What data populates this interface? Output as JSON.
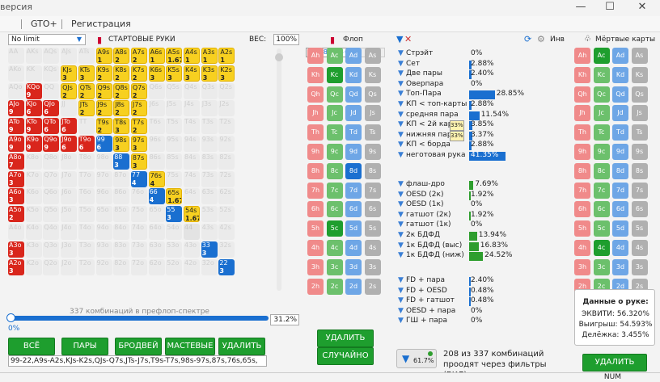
{
  "window": {
    "title": "версия"
  },
  "menu": {
    "items": [
      "GTO+",
      "Регистрация"
    ]
  },
  "left": {
    "mode_select": "No limit",
    "header": "СТАРТОВЫЕ РУКИ",
    "weight_label": "ВЕС:",
    "weight_value": "100%",
    "combos_caption": "337 комбинаций в префлоп-спектре",
    "slider_pct": "31.2%",
    "slider_left": "0%",
    "buttons": [
      "ВСЁ",
      "ПАРЫ",
      "БРОДВЕЙ",
      "МАСТЕВЫЕ",
      "УДАЛИТЬ"
    ],
    "range_text": "99-22,A9s-A2s,KJs-K2s,QJs-Q7s,JTs-J7s,T9s-T7s,98s-97s,87s,76s,65s,"
  },
  "grid": {
    "ranks": [
      "A",
      "K",
      "Q",
      "J",
      "T",
      "9",
      "8",
      "7",
      "6",
      "5",
      "4",
      "3",
      "2"
    ],
    "cells": {
      "A9s": [
        "y",
        "1",
        "2"
      ],
      "A8s": [
        "y",
        "2",
        ""
      ],
      "A7s": [
        "y",
        "2",
        ""
      ],
      "A6s": [
        "y",
        "1",
        ""
      ],
      "A5s": [
        "y",
        "1.67",
        ""
      ],
      "A4s": [
        "y",
        "1",
        ""
      ],
      "A3s": [
        "y",
        "1",
        ""
      ],
      "A2s": [
        "y",
        "1",
        ""
      ],
      "KJs": [
        "y",
        "3",
        ""
      ],
      "KTs": [
        "y",
        "3",
        ""
      ],
      "K9s": [
        "y",
        "2",
        ""
      ],
      "K8s": [
        "y",
        "2",
        ""
      ],
      "K7s": [
        "y",
        "2",
        ""
      ],
      "K6s": [
        "y",
        "3",
        ""
      ],
      "K5s": [
        "y",
        "3",
        ""
      ],
      "K4s": [
        "y",
        "3",
        ""
      ],
      "K3s": [
        "y",
        "3",
        ""
      ],
      "K2s": [
        "y",
        "3",
        ""
      ],
      "KQo": [
        "r",
        "9",
        ""
      ],
      "QJs": [
        "y",
        "2",
        ""
      ],
      "QTs": [
        "y",
        "2",
        ""
      ],
      "Q9s": [
        "y",
        "2",
        ""
      ],
      "Q8s": [
        "y",
        "2",
        ""
      ],
      "Q7s": [
        "y",
        "2",
        ""
      ],
      "AJo": [
        "r",
        "9",
        ""
      ],
      "KJo": [
        "r",
        "6",
        ""
      ],
      "QJo": [
        "r",
        "6",
        ""
      ],
      "JTs": [
        "y",
        "2",
        ""
      ],
      "J9s": [
        "y",
        "2",
        ""
      ],
      "J8s": [
        "y",
        "2",
        ""
      ],
      "J7s": [
        "y",
        "2",
        ""
      ],
      "ATo": [
        "r",
        "9",
        ""
      ],
      "KTo": [
        "r",
        "9",
        ""
      ],
      "QTo": [
        "r",
        "6",
        ""
      ],
      "JTo": [
        "r",
        "6",
        ""
      ],
      "T9s": [
        "y",
        "2",
        ""
      ],
      "T8s": [
        "y",
        "3",
        ""
      ],
      "T7s": [
        "y",
        "2",
        ""
      ],
      "A9o": [
        "r",
        "9",
        ""
      ],
      "K9o": [
        "r",
        "9",
        ""
      ],
      "Q9o": [
        "r",
        "9",
        ""
      ],
      "J9o": [
        "r",
        "6",
        ""
      ],
      "T9o": [
        "r",
        "6",
        ""
      ],
      "99": [
        "b",
        "6",
        ""
      ],
      "98s": [
        "y",
        "3",
        ""
      ],
      "97s": [
        "y",
        "3",
        ""
      ],
      "A8o": [
        "r",
        "7",
        ""
      ],
      "88": [
        "b",
        "3",
        ""
      ],
      "87s": [
        "y",
        "3",
        ""
      ],
      "A7o": [
        "r",
        "3",
        ""
      ],
      "77": [
        "b",
        "4",
        ""
      ],
      "76s": [
        "y",
        "4",
        ""
      ],
      "A6o": [
        "r",
        "3",
        ""
      ],
      "66": [
        "b",
        "4",
        ""
      ],
      "65s": [
        "y",
        "1.67",
        ""
      ],
      "A5o": [
        "r",
        "2",
        ""
      ],
      "55": [
        "b",
        "3",
        ""
      ],
      "54s": [
        "y",
        "1.67",
        ""
      ],
      "A3o": [
        "r",
        "3",
        ""
      ],
      "33": [
        "b",
        "3",
        ""
      ],
      "A2o": [
        "r",
        "3",
        ""
      ],
      "22": [
        "b",
        "3",
        ""
      ]
    },
    "greyed": [
      "44"
    ]
  },
  "flop": {
    "title": "Флоп",
    "board": [
      "K♣",
      "8♦",
      "5♦"
    ],
    "delete_btn": "УДАЛИТЬ",
    "random_btn": "СЛУЧАЙНО"
  },
  "stats": {
    "made": [
      {
        "label": "Стрэйт",
        "pct": "0%",
        "frac": 0
      },
      {
        "label": "Сет",
        "pct": "2.88%",
        "frac": 0.0288
      },
      {
        "label": "Две пары",
        "pct": "2.40%",
        "frac": 0.024
      },
      {
        "label": "Оверпара",
        "pct": "0%",
        "frac": 0
      },
      {
        "label": "Топ-Пара",
        "pct": "28.85%",
        "frac": 0.2885
      },
      {
        "label": "КП < топ-карты",
        "pct": "2.88%",
        "frac": 0.0288
      },
      {
        "label": "средняя пара",
        "pct": "11.54%",
        "frac": 0.1154
      },
      {
        "label": "КП < 2й карты",
        "pct": "3.85%",
        "frac": 0.0385,
        "badge": "33%"
      },
      {
        "label": "нижняя пара",
        "pct": "3.37%",
        "frac": 0.0337,
        "badge": "33%"
      },
      {
        "label": "КП < борда",
        "pct": "2.88%",
        "frac": 0.0288
      },
      {
        "label": "неготовая рука",
        "pct": "41.35%",
        "frac": 0.4135
      }
    ],
    "draws": [
      {
        "label": "флаш-дро",
        "pct": "7.69%",
        "frac": 0.0769
      },
      {
        "label": "OESD (2к)",
        "pct": "1.92%",
        "frac": 0.0192
      },
      {
        "label": "OESD (1к)",
        "pct": "0%",
        "frac": 0
      },
      {
        "label": "гатшот (2к)",
        "pct": "1.92%",
        "frac": 0.0192
      },
      {
        "label": "гатшот (1к)",
        "pct": "0%",
        "frac": 0
      },
      {
        "label": "2к БДФД",
        "pct": "13.94%",
        "frac": 0.1394
      },
      {
        "label": "1к БДФД (выс)",
        "pct": "16.83%",
        "frac": 0.1683
      },
      {
        "label": "1к БДФД (ниж)",
        "pct": "24.52%",
        "frac": 0.2452
      }
    ],
    "combos": [
      {
        "label": "FD + пара",
        "pct": "2.40%",
        "frac": 0.024
      },
      {
        "label": "FD + OESD",
        "pct": "0.48%",
        "frac": 0.0048
      },
      {
        "label": "FD + гатшот",
        "pct": "0.48%",
        "frac": 0.0048
      },
      {
        "label": "OESD + пара",
        "pct": "0%",
        "frac": 0
      },
      {
        "label": "ГШ + пара",
        "pct": "0%",
        "frac": 0
      }
    ],
    "filter_pct": "61.7%",
    "filter_text": "208 из 337 комбинаций проодят через фильтры (ВКЛ)."
  },
  "dead": {
    "title": "Мёртвые карты",
    "inv_label": "Инв",
    "info_title": "Данные о руке:",
    "equity": "ЭКВИТИ: 56.320%",
    "win": "Выигрыш: 54.593%",
    "tie": "Делёжка: 3.455%",
    "delete_btn": "УДАЛИТЬ",
    "status": "NUM"
  },
  "suits_cols": [
    "h",
    "c",
    "d",
    "s"
  ],
  "colors": {
    "red": "#d9261c",
    "yellow": "#f7d020",
    "blue": "#1a6fd0",
    "green": "#1e9e2e"
  }
}
